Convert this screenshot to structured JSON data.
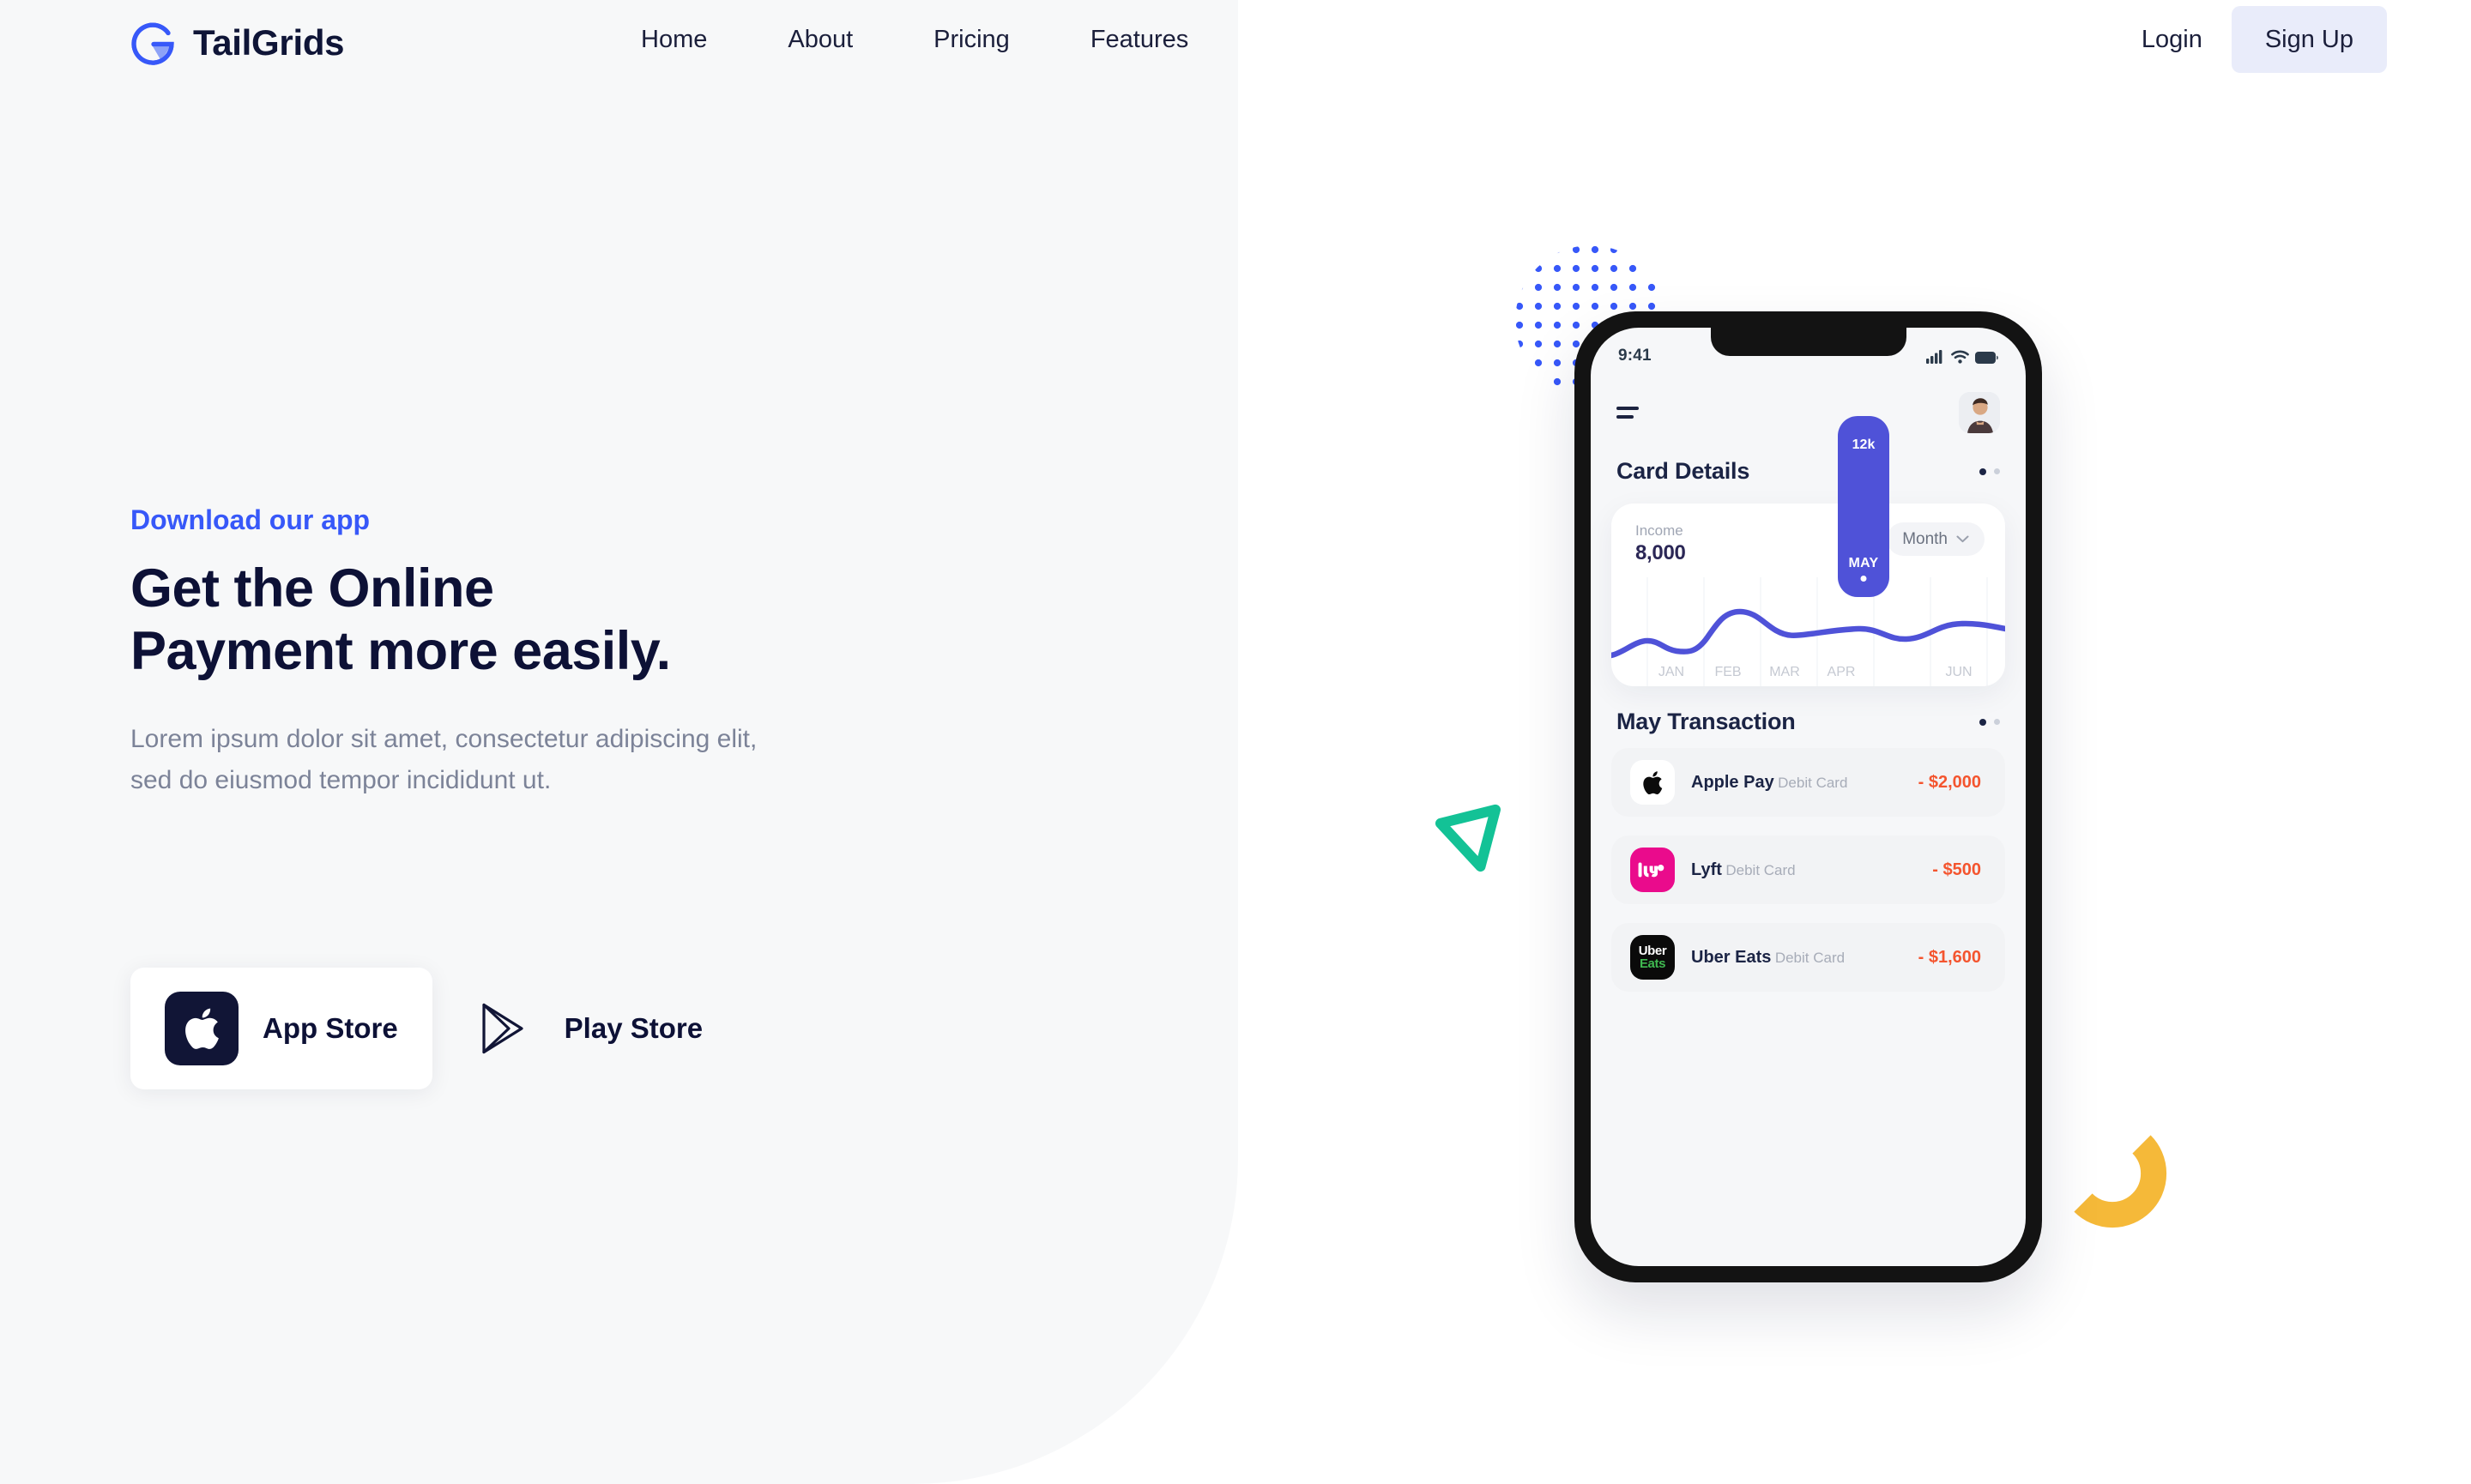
{
  "brand": {
    "name": "TailGrids",
    "mark_icon": "tailgrids-g-logo-icon",
    "color_primary": "#3758f9",
    "color_secondary": "#8da2f7"
  },
  "nav": {
    "links": [
      {
        "label": "Home"
      },
      {
        "label": "About"
      },
      {
        "label": "Pricing"
      },
      {
        "label": "Features"
      }
    ],
    "login_label": "Login",
    "signup_label": "Sign Up",
    "signup_bg": "#e9ecfa"
  },
  "hero": {
    "eyebrow": "Download our app",
    "headline": "Get the Online\nPayment more easily.",
    "subcopy": "Lorem ipsum dolor sit amet, consectetur adipiscing elit,\nsed do eiusmod tempor incididunt ut.",
    "headline_color": "#0d1136",
    "eyebrow_color": "#3758f9"
  },
  "store_buttons": [
    {
      "label": "App Store",
      "icon": "apple-logo-icon"
    },
    {
      "label": "Play Store",
      "icon": "google-play-logo-icon"
    }
  ],
  "decorations": {
    "dot_grid_color": "#3758f9",
    "triangle_color": "#13c296",
    "arc_color": "#f5b939"
  },
  "phone": {
    "status": {
      "time": "9:41",
      "signal_icon": "cellular-bars-icon",
      "wifi_icon": "wifi-icon",
      "battery_icon": "battery-full-icon"
    },
    "header": {
      "menu_icon": "hamburger-menu-icon",
      "avatar_icon": "user-avatar"
    },
    "card_section": {
      "title": "Card Details",
      "pager": [
        "active",
        "inactive"
      ]
    },
    "income_card": {
      "label": "Income",
      "value": "8,000",
      "range_label": "Month",
      "range_chevron_icon": "chevron-down-icon",
      "highlight": {
        "month": "MAY",
        "value_label": "12k",
        "color": "#4f52d8"
      }
    },
    "transactions_section": {
      "title": "May Transaction",
      "pager": [
        "active",
        "inactive"
      ]
    },
    "transactions": [
      {
        "name": "Apple Pay",
        "type": "Debit Card",
        "amount": "- $2,000",
        "logo_icon": "apple-logo-icon",
        "logo_bg": "#ffffff"
      },
      {
        "name": "Lyft",
        "type": "Debit Card",
        "amount": "- $500",
        "logo_icon": "lyft-logo-icon",
        "logo_bg": "#ea0b8c"
      },
      {
        "name": "Uber Eats",
        "type": "Debit Card",
        "amount": "- $1,600",
        "logo_icon": "uber-eats-logo-icon",
        "logo_bg": "#0a0a0a",
        "logo_text_top": "Uber",
        "logo_text_bottom": "Eats"
      }
    ],
    "amount_color": "#f4542e"
  },
  "chart_data": {
    "type": "line",
    "title": "Income",
    "categories": [
      "JAN",
      "FEB",
      "MAR",
      "APR",
      "MAY",
      "JUN"
    ],
    "values": [
      6000,
      5200,
      9000,
      7800,
      12000,
      8600
    ],
    "highlight_category": "MAY",
    "highlight_value": 12000,
    "highlight_label": "12k",
    "summary_value": 8000,
    "summary_value_label": "8,000",
    "range": "Month",
    "xlabel": "",
    "ylabel": "",
    "grid": true,
    "legend": "none",
    "line_color": "#4f52d8"
  }
}
